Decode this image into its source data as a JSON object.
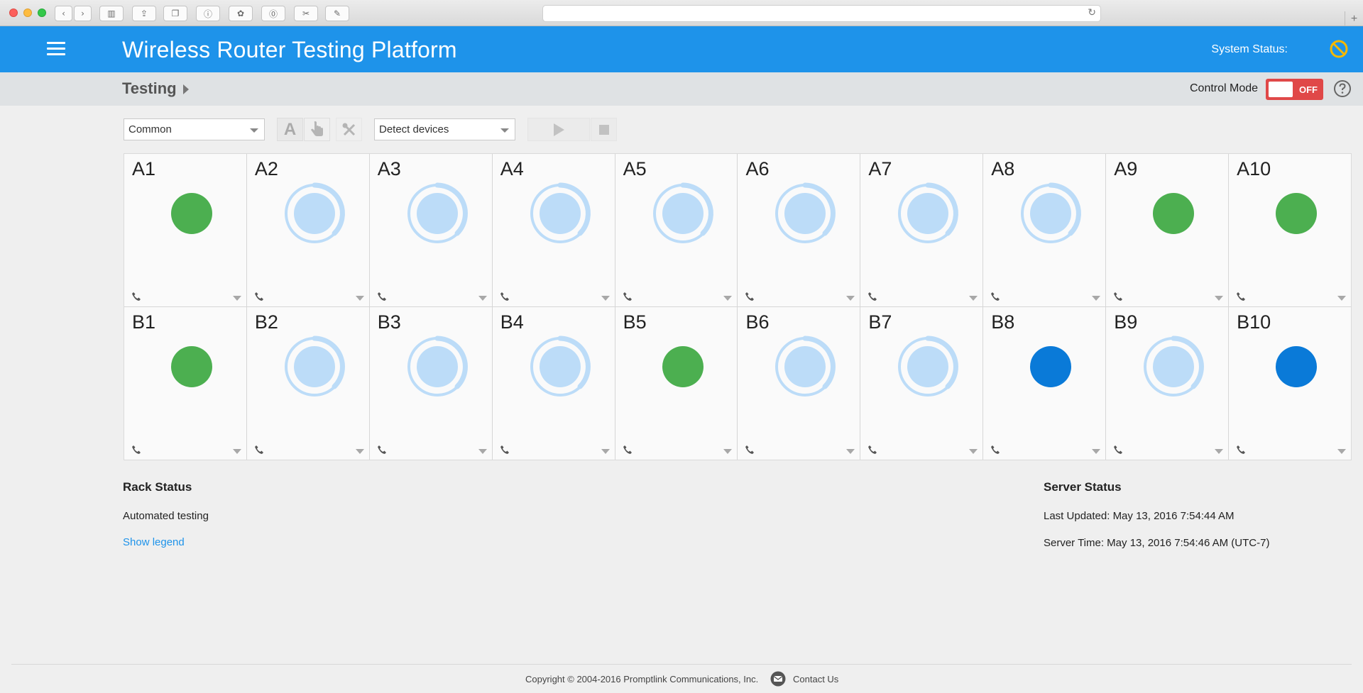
{
  "app": {
    "title": "Wireless Router Testing Platform",
    "system_status_label": "System Status:"
  },
  "breadcrumb": {
    "page_title": "Testing"
  },
  "control_mode": {
    "label": "Control Mode",
    "state": "OFF"
  },
  "toolbar": {
    "profile_select": "Common",
    "action_select": "Detect devices",
    "auto_button": "A"
  },
  "slots": {
    "row_a": [
      {
        "label": "A1",
        "status": "ready"
      },
      {
        "label": "A2",
        "status": "loading"
      },
      {
        "label": "A3",
        "status": "loading"
      },
      {
        "label": "A4",
        "status": "loading"
      },
      {
        "label": "A5",
        "status": "loading"
      },
      {
        "label": "A6",
        "status": "loading"
      },
      {
        "label": "A7",
        "status": "loading"
      },
      {
        "label": "A8",
        "status": "loading"
      },
      {
        "label": "A9",
        "status": "ready"
      },
      {
        "label": "A10",
        "status": "ready"
      }
    ],
    "row_b": [
      {
        "label": "B1",
        "status": "ready"
      },
      {
        "label": "B2",
        "status": "loading"
      },
      {
        "label": "B3",
        "status": "loading"
      },
      {
        "label": "B4",
        "status": "loading"
      },
      {
        "label": "B5",
        "status": "ready"
      },
      {
        "label": "B6",
        "status": "loading"
      },
      {
        "label": "B7",
        "status": "loading"
      },
      {
        "label": "B8",
        "status": "active"
      },
      {
        "label": "B9",
        "status": "loading"
      },
      {
        "label": "B10",
        "status": "active"
      }
    ]
  },
  "status_colors": {
    "ready": "#4caf50",
    "active": "#0a7ad8",
    "loading": "#bcdcf8",
    "header": "#1e93ea"
  },
  "rack_status": {
    "title": "Rack Status",
    "mode": "Automated testing",
    "legend_link": "Show legend"
  },
  "server_status": {
    "title": "Server Status",
    "last_updated": "Last Updated: May 13, 2016 7:54:44 AM",
    "server_time": "Server Time: May 13, 2016 7:54:46 AM (UTC-7)"
  },
  "footer": {
    "copyright": "Copyright © 2004-2016 Promptlink Communications, Inc.",
    "contact": "Contact Us"
  }
}
